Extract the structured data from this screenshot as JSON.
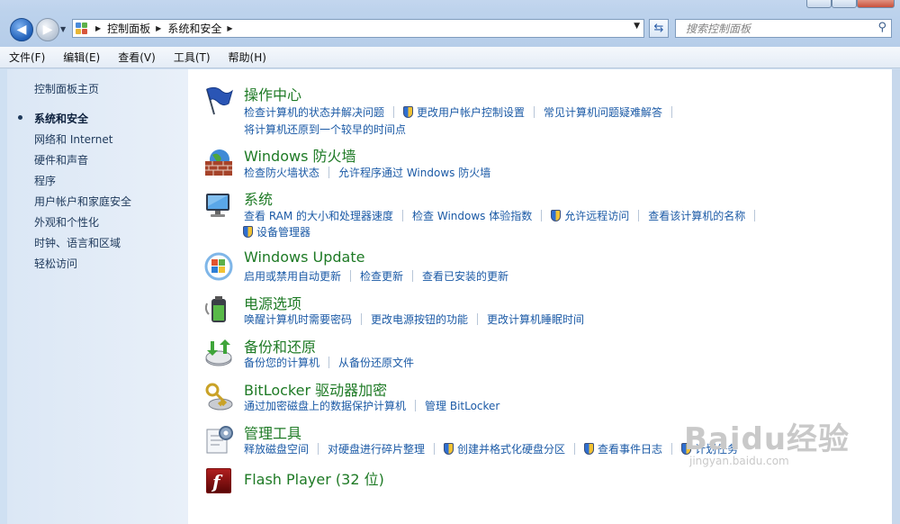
{
  "address_bar": {
    "crumbs": [
      "控制面板",
      "系统和安全"
    ],
    "search_placeholder": "搜索控制面板"
  },
  "menu": [
    "文件(F)",
    "编辑(E)",
    "查看(V)",
    "工具(T)",
    "帮助(H)"
  ],
  "sidebar": {
    "home": "控制面板主页",
    "items": [
      {
        "label": "系统和安全",
        "active": true
      },
      {
        "label": "网络和 Internet"
      },
      {
        "label": "硬件和声音"
      },
      {
        "label": "程序"
      },
      {
        "label": "用户帐户和家庭安全"
      },
      {
        "label": "外观和个性化"
      },
      {
        "label": "时钟、语言和区域"
      },
      {
        "label": "轻松访问"
      }
    ]
  },
  "categories": [
    {
      "title": "操作中心",
      "icon": "action-center-flag-icon",
      "rows": [
        [
          {
            "t": "检查计算机的状态并解决问题"
          },
          {
            "t": "更改用户帐户控制设置",
            "shield": true
          },
          {
            "t": "常见计算机问题疑难解答"
          }
        ],
        [
          {
            "t": "将计算机还原到一个较早的时间点"
          }
        ]
      ]
    },
    {
      "title": "Windows 防火墙",
      "icon": "firewall-icon",
      "rows": [
        [
          {
            "t": "检查防火墙状态"
          },
          {
            "t": "允许程序通过 Windows 防火墙"
          }
        ]
      ]
    },
    {
      "title": "系统",
      "icon": "system-computer-icon",
      "rows": [
        [
          {
            "t": "查看 RAM 的大小和处理器速度"
          },
          {
            "t": "检查 Windows 体验指数"
          },
          {
            "t": "允许远程访问",
            "shield": true
          },
          {
            "t": "查看该计算机的名称"
          }
        ],
        [
          {
            "t": "设备管理器",
            "shield": true
          }
        ]
      ]
    },
    {
      "title": "Windows Update",
      "icon": "windows-update-icon",
      "rows": [
        [
          {
            "t": "启用或禁用自动更新"
          },
          {
            "t": "检查更新"
          },
          {
            "t": "查看已安装的更新"
          }
        ]
      ]
    },
    {
      "title": "电源选项",
      "icon": "power-battery-icon",
      "rows": [
        [
          {
            "t": "唤醒计算机时需要密码"
          },
          {
            "t": "更改电源按钮的功能"
          },
          {
            "t": "更改计算机睡眠时间"
          }
        ]
      ]
    },
    {
      "title": "备份和还原",
      "icon": "backup-restore-icon",
      "rows": [
        [
          {
            "t": "备份您的计算机"
          },
          {
            "t": "从备份还原文件"
          }
        ]
      ]
    },
    {
      "title": "BitLocker 驱动器加密",
      "icon": "bitlocker-key-icon",
      "rows": [
        [
          {
            "t": "通过加密磁盘上的数据保护计算机"
          },
          {
            "t": "管理 BitLocker"
          }
        ]
      ]
    },
    {
      "title": "管理工具",
      "icon": "admin-tools-icon",
      "rows": [
        [
          {
            "t": "释放磁盘空间"
          },
          {
            "t": "对硬盘进行碎片整理"
          },
          {
            "t": "创建并格式化硬盘分区",
            "shield": true
          },
          {
            "t": "查看事件日志",
            "shield": true
          },
          {
            "t": "计划任务",
            "shield": true
          }
        ]
      ]
    },
    {
      "title": "Flash Player (32 位)",
      "icon": "flash-player-icon",
      "rows": []
    }
  ],
  "watermark": {
    "brand": "Baidu经验",
    "url": "jingyan.baidu.com"
  },
  "colors": {
    "category_title": "#1e7a25",
    "link": "#1b5aa6",
    "nav_text": "#1e395b"
  }
}
